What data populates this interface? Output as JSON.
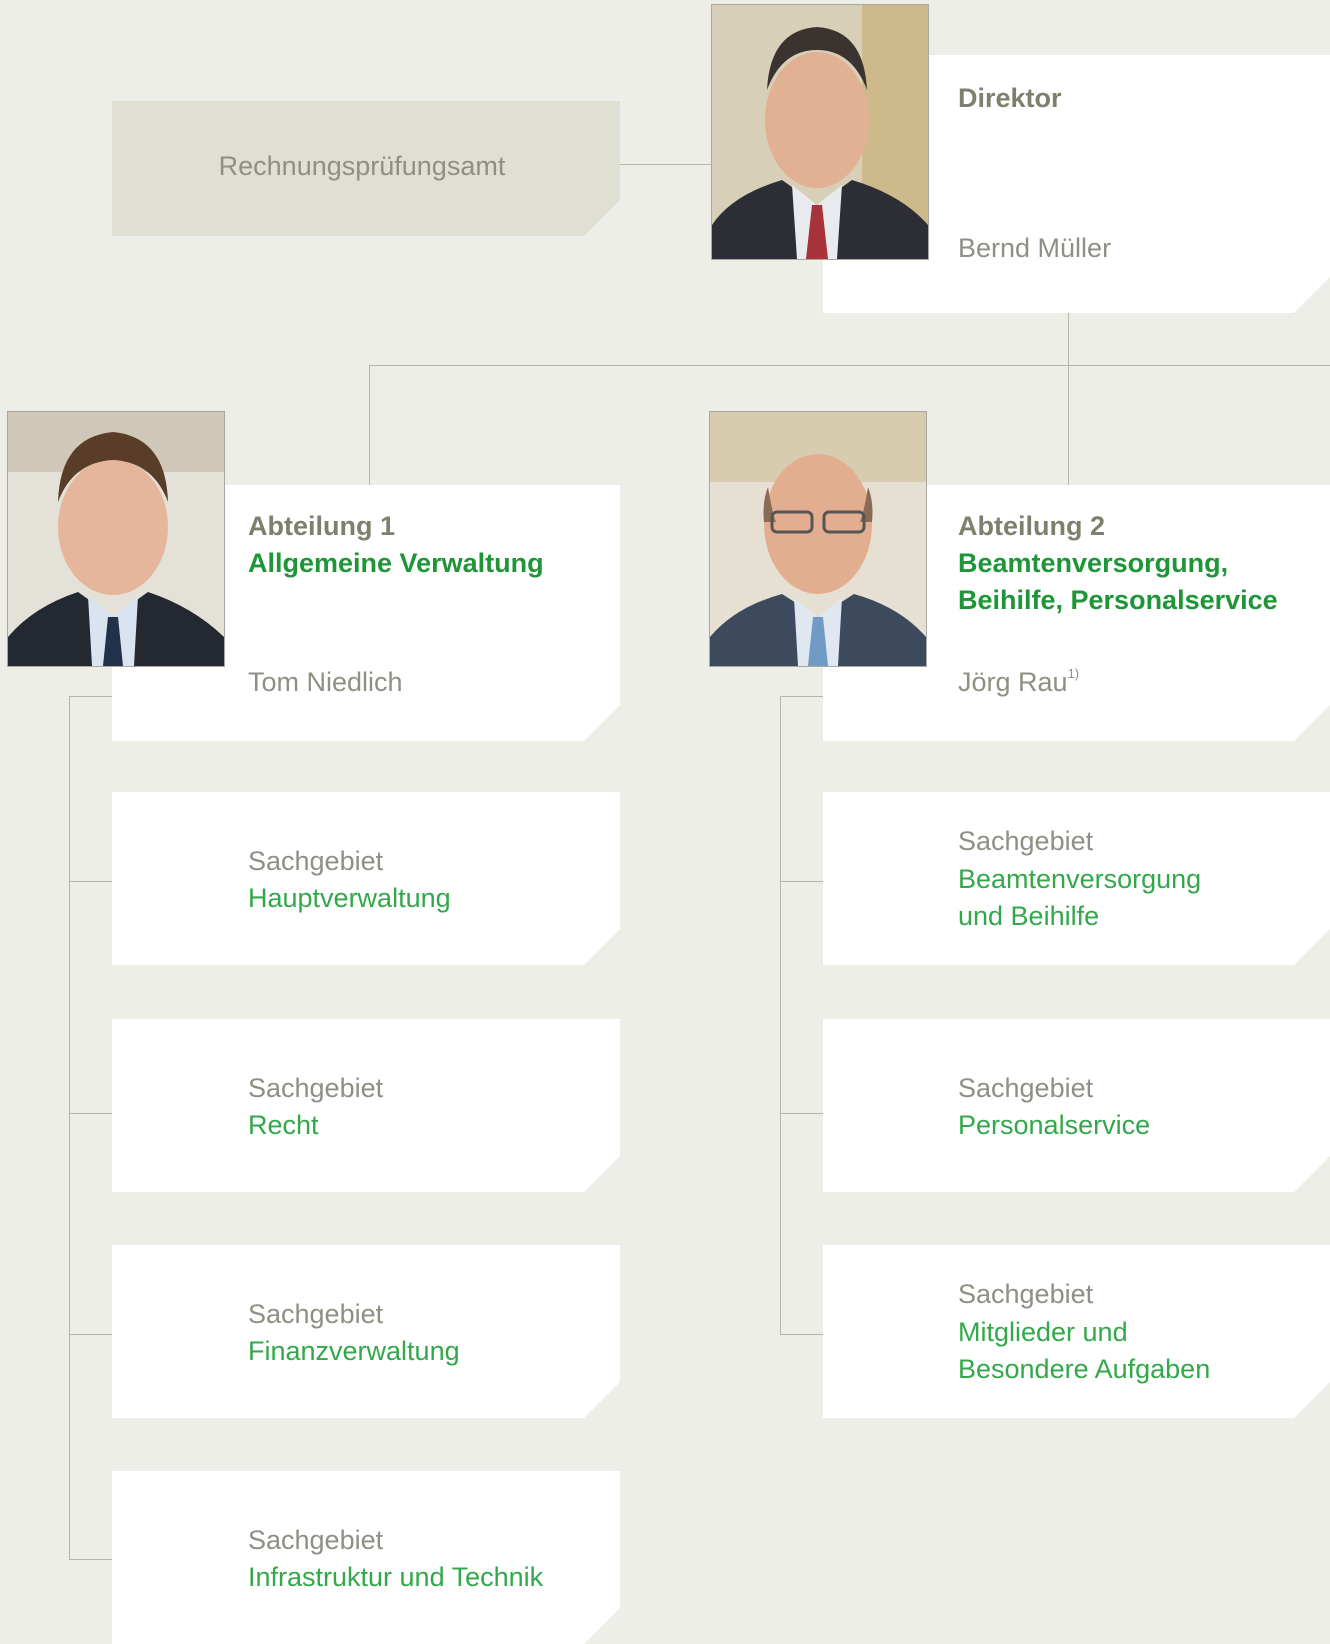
{
  "audit_office": {
    "label": "Rechnungsprüfungsamt"
  },
  "director": {
    "title": "Direktor",
    "name": "Bernd Müller"
  },
  "dept1": {
    "number": "Abteilung 1",
    "name": "Allgemeine Verwaltung",
    "head": "Tom Niedlich",
    "units": [
      {
        "prefix": "Sachgebiet",
        "name": "Hauptverwaltung"
      },
      {
        "prefix": "Sachgebiet",
        "name": "Recht"
      },
      {
        "prefix": "Sachgebiet",
        "name": "Finanzverwaltung"
      },
      {
        "prefix": "Sachgebiet",
        "name": "Infrastruktur und Technik"
      }
    ]
  },
  "dept2": {
    "number": "Abteilung 2",
    "name_line1": "Beamtenversorgung,",
    "name_line2": "Beihilfe, Personalservice",
    "head": "Jörg Rau",
    "head_footnote": "1)",
    "units": [
      {
        "prefix": "Sachgebiet",
        "name_line1": "Beamtenversorgung",
        "name_line2": "und Beihilfe"
      },
      {
        "prefix": "Sachgebiet",
        "name_line1": "Personalservice"
      },
      {
        "prefix": "Sachgebiet",
        "name_line1": "Mitglieder und",
        "name_line2": "Besondere Aufgaben"
      }
    ]
  },
  "colors": {
    "background": "#eeeee9",
    "box": "#ffffff",
    "audit_box": "#dfdfd4",
    "connector": "#b5b5a8",
    "heading_olive": "#7f7f6e",
    "heading_green": "#1e9637",
    "text_gray": "#8f8f86",
    "text_green": "#33a84a"
  }
}
